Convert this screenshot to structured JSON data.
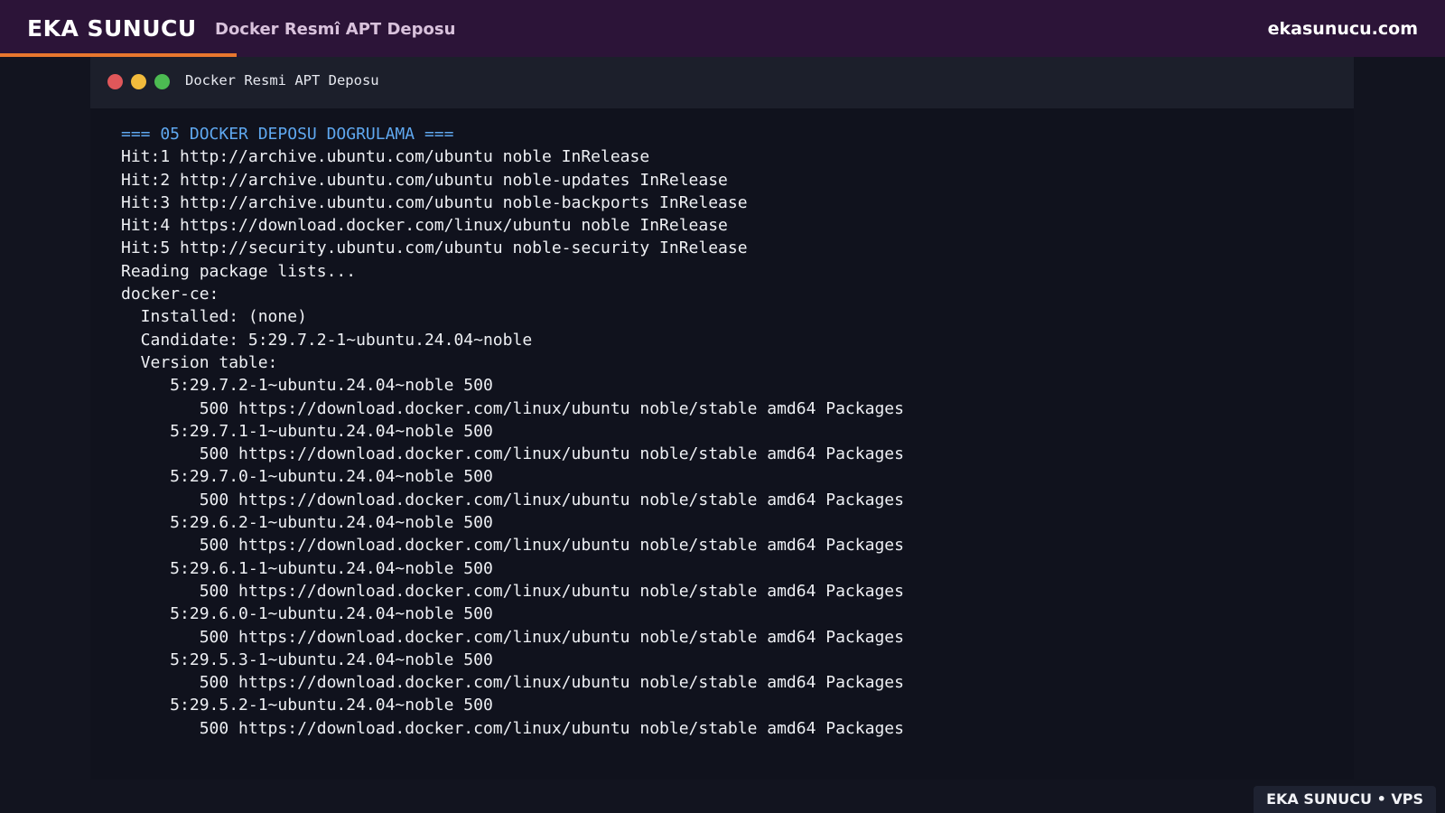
{
  "header": {
    "brand": "EKA SUNUCU",
    "subtitle": "Docker Resmî APT Deposu",
    "site": "ekasunucu.com"
  },
  "terminal": {
    "title": "Docker Resmi APT Deposu",
    "lines": [
      {
        "text": "=== 05 DOCKER DEPOSU DOGRULAMA ===",
        "kind": "heading"
      },
      {
        "text": "Hit:1 http://archive.ubuntu.com/ubuntu noble InRelease",
        "kind": "output"
      },
      {
        "text": "Hit:2 http://archive.ubuntu.com/ubuntu noble-updates InRelease",
        "kind": "output"
      },
      {
        "text": "Hit:3 http://archive.ubuntu.com/ubuntu noble-backports InRelease",
        "kind": "output"
      },
      {
        "text": "Hit:4 https://download.docker.com/linux/ubuntu noble InRelease",
        "kind": "output"
      },
      {
        "text": "Hit:5 http://security.ubuntu.com/ubuntu noble-security InRelease",
        "kind": "output"
      },
      {
        "text": "Reading package lists...",
        "kind": "output"
      },
      {
        "text": "docker-ce:",
        "kind": "output"
      },
      {
        "text": "  Installed: (none)",
        "kind": "output"
      },
      {
        "text": "  Candidate: 5:29.7.2-1~ubuntu.24.04~noble",
        "kind": "output"
      },
      {
        "text": "  Version table:",
        "kind": "output"
      },
      {
        "text": "     5:29.7.2-1~ubuntu.24.04~noble 500",
        "kind": "output"
      },
      {
        "text": "        500 https://download.docker.com/linux/ubuntu noble/stable amd64 Packages",
        "kind": "output"
      },
      {
        "text": "     5:29.7.1-1~ubuntu.24.04~noble 500",
        "kind": "output"
      },
      {
        "text": "        500 https://download.docker.com/linux/ubuntu noble/stable amd64 Packages",
        "kind": "output"
      },
      {
        "text": "     5:29.7.0-1~ubuntu.24.04~noble 500",
        "kind": "output"
      },
      {
        "text": "        500 https://download.docker.com/linux/ubuntu noble/stable amd64 Packages",
        "kind": "output"
      },
      {
        "text": "     5:29.6.2-1~ubuntu.24.04~noble 500",
        "kind": "output"
      },
      {
        "text": "        500 https://download.docker.com/linux/ubuntu noble/stable amd64 Packages",
        "kind": "output"
      },
      {
        "text": "     5:29.6.1-1~ubuntu.24.04~noble 500",
        "kind": "output"
      },
      {
        "text": "        500 https://download.docker.com/linux/ubuntu noble/stable amd64 Packages",
        "kind": "output"
      },
      {
        "text": "     5:29.6.0-1~ubuntu.24.04~noble 500",
        "kind": "output"
      },
      {
        "text": "        500 https://download.docker.com/linux/ubuntu noble/stable amd64 Packages",
        "kind": "output"
      },
      {
        "text": "     5:29.5.3-1~ubuntu.24.04~noble 500",
        "kind": "output"
      },
      {
        "text": "        500 https://download.docker.com/linux/ubuntu noble/stable amd64 Packages",
        "kind": "output"
      },
      {
        "text": "     5:29.5.2-1~ubuntu.24.04~noble 500",
        "kind": "output"
      },
      {
        "text": "        500 https://download.docker.com/linux/ubuntu noble/stable amd64 Packages",
        "kind": "output"
      }
    ]
  },
  "footer": {
    "badge": "EKA SUNUCU • VPS"
  },
  "colors": {
    "topbar": "#2c1438",
    "accent": "#e8772e",
    "heading": "#5fa8f0",
    "dot_red": "#e0575a",
    "dot_yellow": "#f2bb3c",
    "dot_green": "#4cbb52"
  }
}
